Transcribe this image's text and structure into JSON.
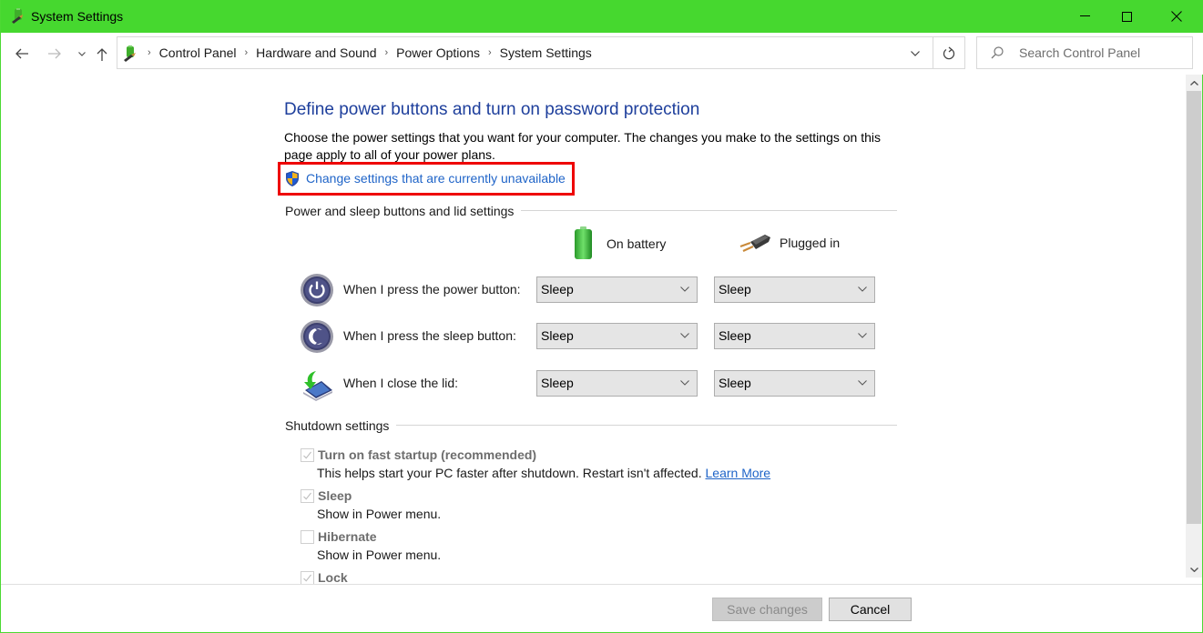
{
  "window": {
    "title": "System Settings",
    "accent_color": "#46d82f",
    "controls": {
      "minimize": "minimize-icon",
      "maximize": "maximize-icon",
      "close": "close-icon"
    }
  },
  "nav": {
    "back": "back-arrow-icon",
    "forward": "forward-arrow-icon",
    "recent": "chevron-down-icon",
    "up": "up-arrow-icon",
    "breadcrumbs": [
      "Control Panel",
      "Hardware and Sound",
      "Power Options",
      "System Settings"
    ],
    "refresh": "refresh-icon",
    "search_placeholder": "Search Control Panel"
  },
  "page": {
    "heading": "Define power buttons and turn on password protection",
    "description": "Choose the power settings that you want for your computer. The changes you make to the settings on this page apply to all of your power plans.",
    "uac_link": "Change settings that are currently unavailable",
    "highlight_color": "#ee0000"
  },
  "buttons_section": {
    "title": "Power and sleep buttons and lid settings",
    "columns": [
      {
        "label": "On battery",
        "icon": "battery-icon"
      },
      {
        "label": "Plugged in",
        "icon": "power-plug-icon"
      }
    ],
    "rows": [
      {
        "label": "When I press the power button:",
        "icon": "power-button-icon",
        "on_battery": "Sleep",
        "plugged_in": "Sleep"
      },
      {
        "label": "When I press the sleep button:",
        "icon": "sleep-button-icon",
        "on_battery": "Sleep",
        "plugged_in": "Sleep"
      },
      {
        "label": "When I close the lid:",
        "icon": "laptop-lid-icon",
        "on_battery": "Sleep",
        "plugged_in": "Sleep"
      }
    ]
  },
  "shutdown_section": {
    "title": "Shutdown settings",
    "items": [
      {
        "label": "Turn on fast startup (recommended)",
        "checked": true,
        "description": "This helps start your PC faster after shutdown. Restart isn't affected.",
        "link": "Learn More"
      },
      {
        "label": "Sleep",
        "checked": true,
        "description": "Show in Power menu."
      },
      {
        "label": "Hibernate",
        "checked": false,
        "description": "Show in Power menu."
      },
      {
        "label": "Lock",
        "checked": true
      }
    ]
  },
  "footer": {
    "save_label": "Save changes",
    "cancel_label": "Cancel"
  }
}
